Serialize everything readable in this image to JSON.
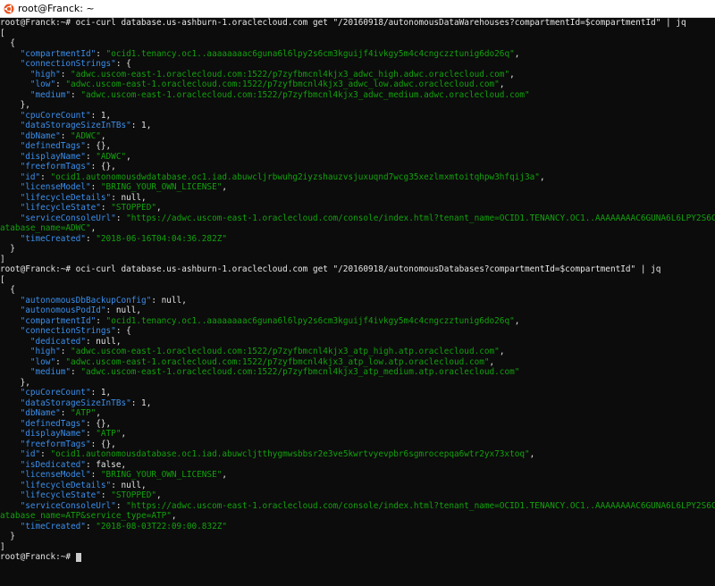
{
  "window": {
    "title": "root@Franck: ~",
    "icon": "ubuntu-icon"
  },
  "colors": {
    "key": "#3b8eea",
    "string": "#13a10e",
    "punct": "#e6e6e6",
    "background": "#0c0c0c"
  },
  "terminal": {
    "lines": [
      [
        {
          "t": "p",
          "v": "root@Franck:~# oci-curl database.us-ashburn-1.oraclecloud.com get \"/20160918/autonomousDataWarehouses?compartmentId=$compartmentId\" | jq"
        }
      ],
      [
        {
          "t": "p",
          "v": "["
        }
      ],
      [
        {
          "t": "p",
          "v": "  {"
        }
      ],
      [
        {
          "t": "p",
          "v": "    "
        },
        {
          "t": "k",
          "v": "\"compartmentId\""
        },
        {
          "t": "p",
          "v": ": "
        },
        {
          "t": "s",
          "v": "\"ocid1.tenancy.oc1..aaaaaaaac6guna6l6lpy2s6cm3kguijf4ivkgy5m4c4cngczztunig6do26q\""
        },
        {
          "t": "p",
          "v": ","
        }
      ],
      [
        {
          "t": "p",
          "v": "    "
        },
        {
          "t": "k",
          "v": "\"connectionStrings\""
        },
        {
          "t": "p",
          "v": ": {"
        }
      ],
      [
        {
          "t": "p",
          "v": "      "
        },
        {
          "t": "k",
          "v": "\"high\""
        },
        {
          "t": "p",
          "v": ": "
        },
        {
          "t": "s",
          "v": "\"adwc.uscom-east-1.oraclecloud.com:1522/p7zyfbmcnl4kjx3_adwc_high.adwc.oraclecloud.com\""
        },
        {
          "t": "p",
          "v": ","
        }
      ],
      [
        {
          "t": "p",
          "v": "      "
        },
        {
          "t": "k",
          "v": "\"low\""
        },
        {
          "t": "p",
          "v": ": "
        },
        {
          "t": "s",
          "v": "\"adwc.uscom-east-1.oraclecloud.com:1522/p7zyfbmcnl4kjx3_adwc_low.adwc.oraclecloud.com\""
        },
        {
          "t": "p",
          "v": ","
        }
      ],
      [
        {
          "t": "p",
          "v": "      "
        },
        {
          "t": "k",
          "v": "\"medium\""
        },
        {
          "t": "p",
          "v": ": "
        },
        {
          "t": "s",
          "v": "\"adwc.uscom-east-1.oraclecloud.com:1522/p7zyfbmcnl4kjx3_adwc_medium.adwc.oraclecloud.com\""
        }
      ],
      [
        {
          "t": "p",
          "v": "    },"
        }
      ],
      [
        {
          "t": "p",
          "v": "    "
        },
        {
          "t": "k",
          "v": "\"cpuCoreCount\""
        },
        {
          "t": "p",
          "v": ": 1,"
        }
      ],
      [
        {
          "t": "p",
          "v": "    "
        },
        {
          "t": "k",
          "v": "\"dataStorageSizeInTBs\""
        },
        {
          "t": "p",
          "v": ": 1,"
        }
      ],
      [
        {
          "t": "p",
          "v": "    "
        },
        {
          "t": "k",
          "v": "\"dbName\""
        },
        {
          "t": "p",
          "v": ": "
        },
        {
          "t": "s",
          "v": "\"ADWC\""
        },
        {
          "t": "p",
          "v": ","
        }
      ],
      [
        {
          "t": "p",
          "v": "    "
        },
        {
          "t": "k",
          "v": "\"definedTags\""
        },
        {
          "t": "p",
          "v": ": {},"
        }
      ],
      [
        {
          "t": "p",
          "v": "    "
        },
        {
          "t": "k",
          "v": "\"displayName\""
        },
        {
          "t": "p",
          "v": ": "
        },
        {
          "t": "s",
          "v": "\"ADWC\""
        },
        {
          "t": "p",
          "v": ","
        }
      ],
      [
        {
          "t": "p",
          "v": "    "
        },
        {
          "t": "k",
          "v": "\"freeformTags\""
        },
        {
          "t": "p",
          "v": ": {},"
        }
      ],
      [
        {
          "t": "p",
          "v": "    "
        },
        {
          "t": "k",
          "v": "\"id\""
        },
        {
          "t": "p",
          "v": ": "
        },
        {
          "t": "s",
          "v": "\"ocid1.autonomousdwdatabase.oc1.iad.abuwcljrbwuhg2iyzshauzvsjuxuqnd7wcg35xezlmxmtoitqhpw3hfqij3a\""
        },
        {
          "t": "p",
          "v": ","
        }
      ],
      [
        {
          "t": "p",
          "v": "    "
        },
        {
          "t": "k",
          "v": "\"licenseModel\""
        },
        {
          "t": "p",
          "v": ": "
        },
        {
          "t": "s",
          "v": "\"BRING_YOUR_OWN_LICENSE\""
        },
        {
          "t": "p",
          "v": ","
        }
      ],
      [
        {
          "t": "p",
          "v": "    "
        },
        {
          "t": "k",
          "v": "\"lifecycleDetails\""
        },
        {
          "t": "p",
          "v": ": null,"
        }
      ],
      [
        {
          "t": "p",
          "v": "    "
        },
        {
          "t": "k",
          "v": "\"lifecycleState\""
        },
        {
          "t": "p",
          "v": ": "
        },
        {
          "t": "s",
          "v": "\"STOPPED\""
        },
        {
          "t": "p",
          "v": ","
        }
      ],
      [
        {
          "t": "p",
          "v": "    "
        },
        {
          "t": "k",
          "v": "\"serviceConsoleUrl\""
        },
        {
          "t": "p",
          "v": ": "
        },
        {
          "t": "s",
          "v": "\"https://adwc.uscom-east-1.oraclecloud.com/console/index.html?tenant_name=OCID1.TENANCY.OC1..AAAAAAAAC6GUNA6L6LPY2S6C"
        }
      ],
      [
        {
          "t": "s",
          "v": "atabase_name=ADWC\""
        },
        {
          "t": "p",
          "v": ","
        }
      ],
      [
        {
          "t": "p",
          "v": "    "
        },
        {
          "t": "k",
          "v": "\"timeCreated\""
        },
        {
          "t": "p",
          "v": ": "
        },
        {
          "t": "s",
          "v": "\"2018-06-16T04:04:36.282Z\""
        }
      ],
      [
        {
          "t": "p",
          "v": "  }"
        }
      ],
      [
        {
          "t": "p",
          "v": "]"
        }
      ],
      [
        {
          "t": "p",
          "v": "root@Franck:~# oci-curl database.us-ashburn-1.oraclecloud.com get \"/20160918/autonomousDatabases?compartmentId=$compartmentId\" | jq"
        }
      ],
      [
        {
          "t": "p",
          "v": "["
        }
      ],
      [
        {
          "t": "p",
          "v": "  {"
        }
      ],
      [
        {
          "t": "p",
          "v": "    "
        },
        {
          "t": "k",
          "v": "\"autonomousDbBackupConfig\""
        },
        {
          "t": "p",
          "v": ": null,"
        }
      ],
      [
        {
          "t": "p",
          "v": "    "
        },
        {
          "t": "k",
          "v": "\"autonomousPodId\""
        },
        {
          "t": "p",
          "v": ": null,"
        }
      ],
      [
        {
          "t": "p",
          "v": "    "
        },
        {
          "t": "k",
          "v": "\"compartmentId\""
        },
        {
          "t": "p",
          "v": ": "
        },
        {
          "t": "s",
          "v": "\"ocid1.tenancy.oc1..aaaaaaaac6guna6l6lpy2s6cm3kguijf4ivkgy5m4c4cngczztunig6do26q\""
        },
        {
          "t": "p",
          "v": ","
        }
      ],
      [
        {
          "t": "p",
          "v": "    "
        },
        {
          "t": "k",
          "v": "\"connectionStrings\""
        },
        {
          "t": "p",
          "v": ": {"
        }
      ],
      [
        {
          "t": "p",
          "v": "      "
        },
        {
          "t": "k",
          "v": "\"dedicated\""
        },
        {
          "t": "p",
          "v": ": null,"
        }
      ],
      [
        {
          "t": "p",
          "v": "      "
        },
        {
          "t": "k",
          "v": "\"high\""
        },
        {
          "t": "p",
          "v": ": "
        },
        {
          "t": "s",
          "v": "\"adwc.uscom-east-1.oraclecloud.com:1522/p7zyfbmcnl4kjx3_atp_high.atp.oraclecloud.com\""
        },
        {
          "t": "p",
          "v": ","
        }
      ],
      [
        {
          "t": "p",
          "v": "      "
        },
        {
          "t": "k",
          "v": "\"low\""
        },
        {
          "t": "p",
          "v": ": "
        },
        {
          "t": "s",
          "v": "\"adwc.uscom-east-1.oraclecloud.com:1522/p7zyfbmcnl4kjx3_atp_low.atp.oraclecloud.com\""
        },
        {
          "t": "p",
          "v": ","
        }
      ],
      [
        {
          "t": "p",
          "v": "      "
        },
        {
          "t": "k",
          "v": "\"medium\""
        },
        {
          "t": "p",
          "v": ": "
        },
        {
          "t": "s",
          "v": "\"adwc.uscom-east-1.oraclecloud.com:1522/p7zyfbmcnl4kjx3_atp_medium.atp.oraclecloud.com\""
        }
      ],
      [
        {
          "t": "p",
          "v": "    },"
        }
      ],
      [
        {
          "t": "p",
          "v": "    "
        },
        {
          "t": "k",
          "v": "\"cpuCoreCount\""
        },
        {
          "t": "p",
          "v": ": 1,"
        }
      ],
      [
        {
          "t": "p",
          "v": "    "
        },
        {
          "t": "k",
          "v": "\"dataStorageSizeInTBs\""
        },
        {
          "t": "p",
          "v": ": 1,"
        }
      ],
      [
        {
          "t": "p",
          "v": "    "
        },
        {
          "t": "k",
          "v": "\"dbName\""
        },
        {
          "t": "p",
          "v": ": "
        },
        {
          "t": "s",
          "v": "\"ATP\""
        },
        {
          "t": "p",
          "v": ","
        }
      ],
      [
        {
          "t": "p",
          "v": "    "
        },
        {
          "t": "k",
          "v": "\"definedTags\""
        },
        {
          "t": "p",
          "v": ": {},"
        }
      ],
      [
        {
          "t": "p",
          "v": "    "
        },
        {
          "t": "k",
          "v": "\"displayName\""
        },
        {
          "t": "p",
          "v": ": "
        },
        {
          "t": "s",
          "v": "\"ATP\""
        },
        {
          "t": "p",
          "v": ","
        }
      ],
      [
        {
          "t": "p",
          "v": "    "
        },
        {
          "t": "k",
          "v": "\"freeformTags\""
        },
        {
          "t": "p",
          "v": ": {},"
        }
      ],
      [
        {
          "t": "p",
          "v": "    "
        },
        {
          "t": "k",
          "v": "\"id\""
        },
        {
          "t": "p",
          "v": ": "
        },
        {
          "t": "s",
          "v": "\"ocid1.autonomousdatabase.oc1.iad.abuwcljtthygmwsbbsr2e3ve5kwrtvyevpbr6sgmrocepqa6wtr2yx73xtoq\""
        },
        {
          "t": "p",
          "v": ","
        }
      ],
      [
        {
          "t": "p",
          "v": "    "
        },
        {
          "t": "k",
          "v": "\"isDedicated\""
        },
        {
          "t": "p",
          "v": ": false,"
        }
      ],
      [
        {
          "t": "p",
          "v": "    "
        },
        {
          "t": "k",
          "v": "\"licenseModel\""
        },
        {
          "t": "p",
          "v": ": "
        },
        {
          "t": "s",
          "v": "\"BRING_YOUR_OWN_LICENSE\""
        },
        {
          "t": "p",
          "v": ","
        }
      ],
      [
        {
          "t": "p",
          "v": "    "
        },
        {
          "t": "k",
          "v": "\"lifecycleDetails\""
        },
        {
          "t": "p",
          "v": ": null,"
        }
      ],
      [
        {
          "t": "p",
          "v": "    "
        },
        {
          "t": "k",
          "v": "\"lifecycleState\""
        },
        {
          "t": "p",
          "v": ": "
        },
        {
          "t": "s",
          "v": "\"STOPPED\""
        },
        {
          "t": "p",
          "v": ","
        }
      ],
      [
        {
          "t": "p",
          "v": "    "
        },
        {
          "t": "k",
          "v": "\"serviceConsoleUrl\""
        },
        {
          "t": "p",
          "v": ": "
        },
        {
          "t": "s",
          "v": "\"https://adwc.uscom-east-1.oraclecloud.com/console/index.html?tenant_name=OCID1.TENANCY.OC1..AAAAAAAAC6GUNA6L6LPY2S6C"
        }
      ],
      [
        {
          "t": "s",
          "v": "atabase_name=ATP&service_type=ATP\""
        },
        {
          "t": "p",
          "v": ","
        }
      ],
      [
        {
          "t": "p",
          "v": "    "
        },
        {
          "t": "k",
          "v": "\"timeCreated\""
        },
        {
          "t": "p",
          "v": ": "
        },
        {
          "t": "s",
          "v": "\"2018-08-03T22:09:00.832Z\""
        }
      ],
      [
        {
          "t": "p",
          "v": "  }"
        }
      ],
      [
        {
          "t": "p",
          "v": "]"
        }
      ],
      [
        {
          "t": "p",
          "v": "root@Franck:~# "
        }
      ]
    ]
  }
}
